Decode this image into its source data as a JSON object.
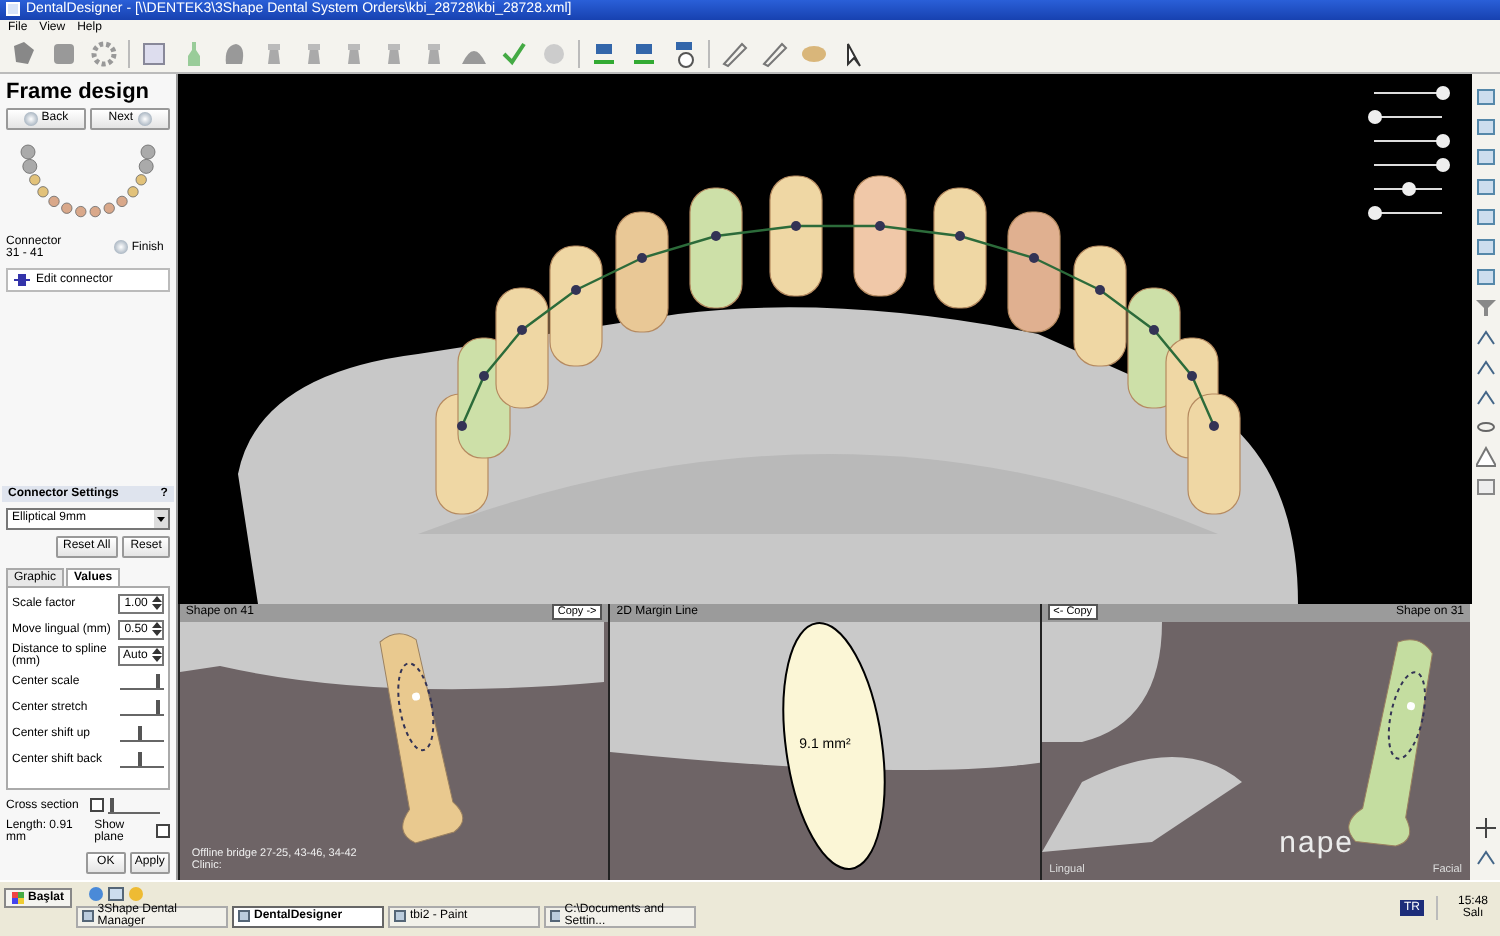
{
  "window": {
    "title": "DentalDesigner - [\\\\DENTEK3\\3Shape Dental System Orders\\kbi_28728\\kbi_28728.xml]"
  },
  "menu": [
    "File",
    "View",
    "Help"
  ],
  "side_panel": {
    "title": "Frame design",
    "back": "Back",
    "next": "Next",
    "connector": "Connector 31 - 41",
    "finish": "Finish",
    "edit_connector": "Edit connector"
  },
  "connector_settings": {
    "title": "Connector Settings",
    "help": "?",
    "profile": "Elliptical 9mm",
    "reset_all": "Reset All",
    "reset": "Reset",
    "tabs": [
      {
        "label": "Graphic",
        "selected": false
      },
      {
        "label": "Values",
        "selected": true
      }
    ],
    "fields": [
      {
        "kind": "spin",
        "label": "Scale factor",
        "value": "1.00"
      },
      {
        "kind": "spin",
        "label": "Move lingual (mm)",
        "value": "0.50"
      },
      {
        "kind": "spin",
        "label": "Distance to spline (mm)",
        "value": "Auto"
      },
      {
        "kind": "slider",
        "label": "Center scale",
        "level": 0.85
      },
      {
        "kind": "slider",
        "label": "Center stretch",
        "level": 0.85
      },
      {
        "kind": "slider",
        "label": "Center shift up",
        "level": 0.45
      },
      {
        "kind": "slider",
        "label": "Center shift back",
        "level": 0.45
      }
    ],
    "cross_section": {
      "label": "Cross section",
      "checked": false,
      "level": 0.05
    },
    "length": "Length: 0.91 mm",
    "show_plane": {
      "label": "Show plane",
      "checked": false
    },
    "ok": "OK",
    "apply": "Apply"
  },
  "viewport": {
    "visibility_sliders": [
      {
        "level": 1
      },
      {
        "level": 0
      },
      {
        "level": 1
      },
      {
        "level": 1
      },
      {
        "level": 0.5
      },
      {
        "level": 0
      }
    ],
    "panels": [
      {
        "title": "Shape on 41",
        "copy": "Copy ->",
        "notes": [
          "Offline bridge 27-25, 43-46, 34-42",
          "Clinic:"
        ]
      },
      {
        "title": "2D Margin Line",
        "area": "9.1 mm²"
      },
      {
        "title": "Shape on 31",
        "copy": "<- Copy",
        "left_label": "Lingual",
        "right_label": "Facial",
        "logo": "nape"
      }
    ]
  },
  "taskbar": {
    "start": "Başlat",
    "tasks": [
      {
        "label": "3Shape Dental Manager",
        "selected": false
      },
      {
        "label": "DentalDesigner",
        "selected": true
      },
      {
        "label": "tbi2 - Paint",
        "selected": false
      },
      {
        "label": "C:\\Documents and Settin...",
        "selected": false
      }
    ],
    "language": "TR",
    "time": "15:48",
    "day": "Salı"
  }
}
